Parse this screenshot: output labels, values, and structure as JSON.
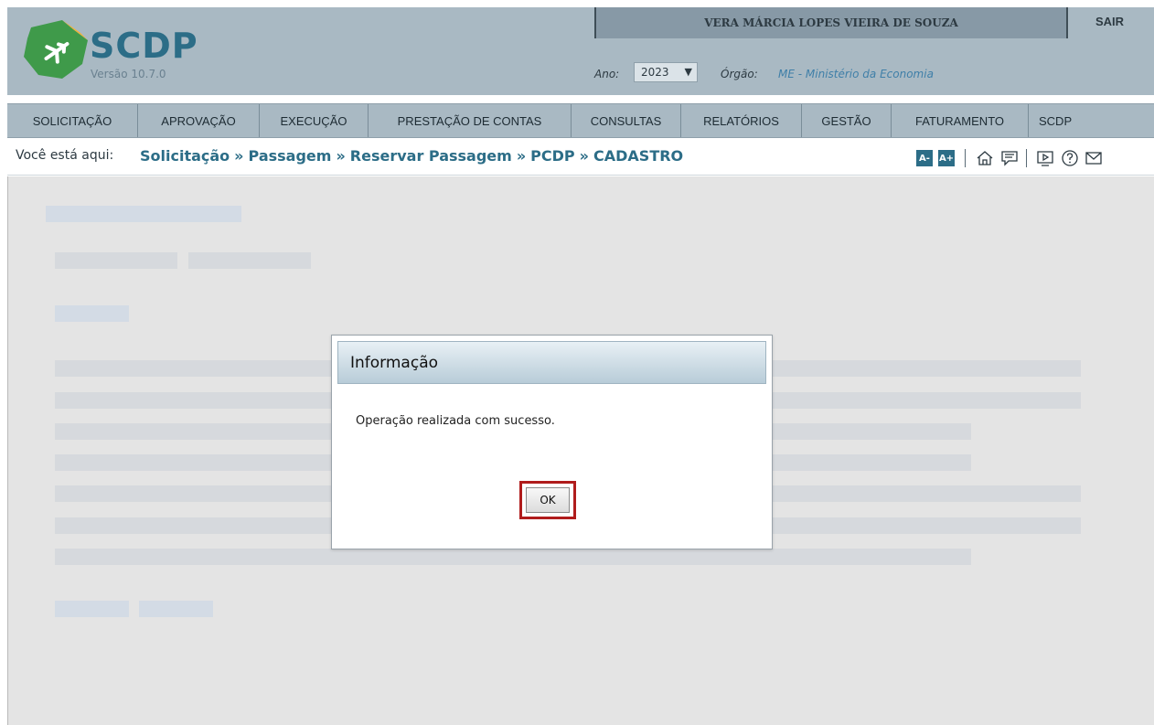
{
  "app": {
    "name": "SCDP",
    "version": "Versão 10.7.0"
  },
  "header": {
    "user_name": "VERA MÁRCIA LOPES VIEIRA DE SOUZA",
    "logout_label": "SAIR",
    "year_label": "Ano:",
    "year_value": "2023",
    "org_label": "Órgão:",
    "org_value": "ME - Ministério da Economia"
  },
  "nav": {
    "items": [
      {
        "label": "SOLICITAÇÃO"
      },
      {
        "label": "APROVAÇÃO"
      },
      {
        "label": "EXECUÇÃO"
      },
      {
        "label": "PRESTAÇÃO DE CONTAS"
      },
      {
        "label": "CONSULTAS"
      },
      {
        "label": "RELATÓRIOS"
      },
      {
        "label": "GESTÃO"
      },
      {
        "label": "FATURAMENTO"
      },
      {
        "label": "SCDP"
      }
    ]
  },
  "breadcrumb": {
    "prefix": "Você está aqui:",
    "items": [
      "Solicitação",
      "Passagem",
      "Reservar Passagem",
      "PCDP",
      "CADASTRO"
    ]
  },
  "toolbar": {
    "font_decrease": "A-",
    "font_increase": "A+",
    "icons": [
      "home-icon",
      "chat-icon",
      "video-icon",
      "help-icon",
      "mail-icon"
    ]
  },
  "dialog": {
    "title": "Informação",
    "message": "Operação realizada com sucesso.",
    "ok_label": "OK"
  },
  "colors": {
    "header_bg": "#a9b9c3",
    "brand": "#2c6d87",
    "highlight_border": "#b01c1c"
  }
}
